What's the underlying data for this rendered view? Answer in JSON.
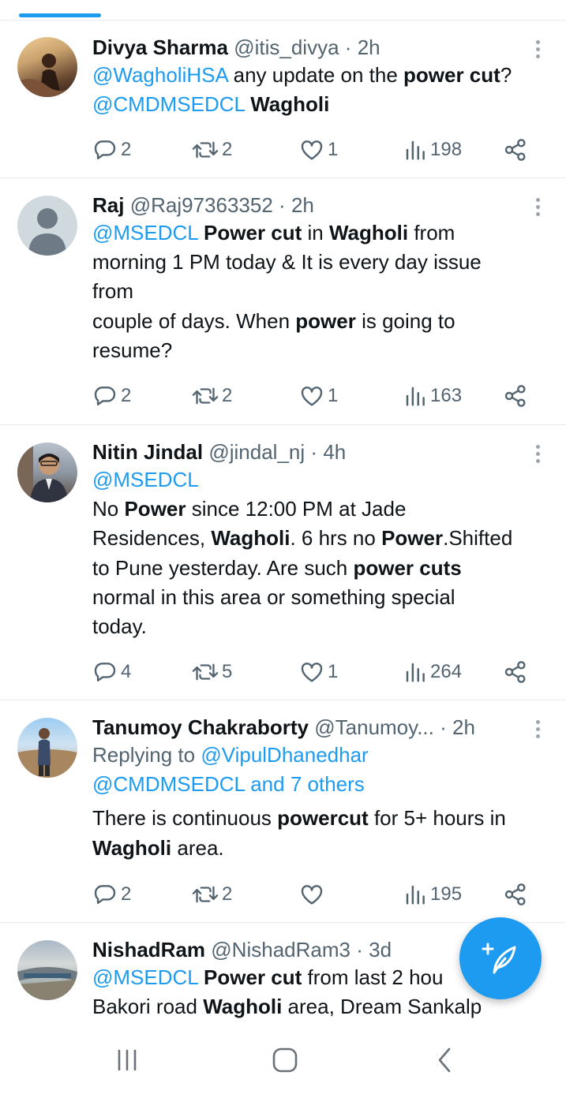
{
  "colors": {
    "accent": "#1d9bf0",
    "text": "#0f1419",
    "muted": "#536471",
    "divider": "#e6ecf0"
  },
  "tweets": [
    {
      "name": "Divya Sharma",
      "handle": "@itis_divya",
      "sep": "·",
      "time": "2h",
      "avatar_icon": "user-photo-icon",
      "body": [
        {
          "t": "@WagholiHSA",
          "s": "mention"
        },
        {
          "t": " any update on the ",
          "s": "plain"
        },
        {
          "t": "power cut",
          "s": "bold"
        },
        {
          "t": "?",
          "s": "plain"
        },
        {
          "t": "\n",
          "s": "plain"
        },
        {
          "t": "@CMDMSEDCL",
          "s": "mention"
        },
        {
          "t": " ",
          "s": "plain"
        },
        {
          "t": "Wagholi",
          "s": "bold"
        }
      ],
      "replies": "2",
      "retweets": "2",
      "likes": "1",
      "views": "198"
    },
    {
      "name": "Raj",
      "handle": "@Raj97363352",
      "sep": "·",
      "time": "2h",
      "avatar_icon": "default-avatar-icon",
      "body": [
        {
          "t": "@MSEDCL",
          "s": "mention"
        },
        {
          "t": " ",
          "s": "plain"
        },
        {
          "t": "Power cut",
          "s": "bold"
        },
        {
          "t": " in ",
          "s": "plain"
        },
        {
          "t": "Wagholi",
          "s": "bold"
        },
        {
          "t": " from",
          "s": "plain"
        },
        {
          "t": "\n",
          "s": "plain"
        },
        {
          "t": "morning 1 PM today & It is every day issue",
          "s": "plain"
        },
        {
          "t": "\n",
          "s": "plain"
        },
        {
          "t": "from",
          "s": "plain"
        },
        {
          "t": "\n",
          "s": "plain"
        },
        {
          "t": "couple of days. When ",
          "s": "plain"
        },
        {
          "t": "power",
          "s": "bold"
        },
        {
          "t": " is going to",
          "s": "plain"
        },
        {
          "t": "\n",
          "s": "plain"
        },
        {
          "t": "resume?",
          "s": "plain"
        }
      ],
      "replies": "2",
      "retweets": "2",
      "likes": "1",
      "views": "163"
    },
    {
      "name": "Nitin Jindal",
      "handle": "@jindal_nj",
      "sep": "·",
      "time": "4h",
      "avatar_icon": "user-photo-icon",
      "body": [
        {
          "t": "@MSEDCL",
          "s": "mention"
        },
        {
          "t": "\n",
          "s": "plain"
        },
        {
          "t": "No ",
          "s": "plain"
        },
        {
          "t": "Power",
          "s": "bold"
        },
        {
          "t": " since 12:00 PM at Jade",
          "s": "plain"
        },
        {
          "t": "\n",
          "s": "plain"
        },
        {
          "t": "Residences, ",
          "s": "plain"
        },
        {
          "t": "Wagholi",
          "s": "bold"
        },
        {
          "t": ". 6 hrs no ",
          "s": "plain"
        },
        {
          "t": "Power",
          "s": "bold"
        },
        {
          "t": ".Shifted",
          "s": "plain"
        },
        {
          "t": "\n",
          "s": "plain"
        },
        {
          "t": "to Pune yesterday. Are such ",
          "s": "plain"
        },
        {
          "t": "power cuts",
          "s": "bold"
        },
        {
          "t": "\n",
          "s": "plain"
        },
        {
          "t": "normal in this area or something special",
          "s": "plain"
        },
        {
          "t": "\n",
          "s": "plain"
        },
        {
          "t": "today.",
          "s": "plain"
        }
      ],
      "replies": "4",
      "retweets": "5",
      "likes": "1",
      "views": "264"
    },
    {
      "name": "Tanumoy Chakraborty",
      "handle": "@Tanumoy...",
      "sep": "·",
      "time": "2h",
      "avatar_icon": "user-photo-icon",
      "body": [
        {
          "t": "Replying to ",
          "s": "muted"
        },
        {
          "t": "@VipulDhanedhar",
          "s": "mention"
        },
        {
          "t": "\n",
          "s": "plain"
        },
        {
          "t": "@CMDMSEDCL and 7 others",
          "s": "mention"
        },
        {
          "t": "\n",
          "s": "gap"
        },
        {
          "t": "There is continuous ",
          "s": "plain"
        },
        {
          "t": "powercut",
          "s": "bold"
        },
        {
          "t": " for 5+ hours in",
          "s": "plain"
        },
        {
          "t": "\n",
          "s": "plain"
        },
        {
          "t": "Wagholi",
          "s": "bold"
        },
        {
          "t": " area.",
          "s": "plain"
        }
      ],
      "replies": "2",
      "retweets": "2",
      "likes": "",
      "views": "195"
    },
    {
      "name": "NishadRam",
      "handle": "@NishadRam3",
      "sep": "·",
      "time": "3d",
      "avatar_icon": "user-photo-icon",
      "body": [
        {
          "t": "@MSEDCL",
          "s": "mention"
        },
        {
          "t": " ",
          "s": "plain"
        },
        {
          "t": "Power cut",
          "s": "bold"
        },
        {
          "t": " from last 2 hou",
          "s": "plain"
        },
        {
          "t": "\n",
          "s": "plain"
        },
        {
          "t": "Bakori road ",
          "s": "plain"
        },
        {
          "t": "Wagholi",
          "s": "bold"
        },
        {
          "t": " area, Dream Sankalp",
          "s": "plain"
        }
      ],
      "replies": "",
      "retweets": "",
      "likes": "",
      "views": ""
    }
  ],
  "fab": {
    "icon": "compose-post-icon"
  },
  "navbar": {
    "recent_icon": "recent-apps-icon",
    "home_icon": "home-icon",
    "back_icon": "back-icon"
  }
}
